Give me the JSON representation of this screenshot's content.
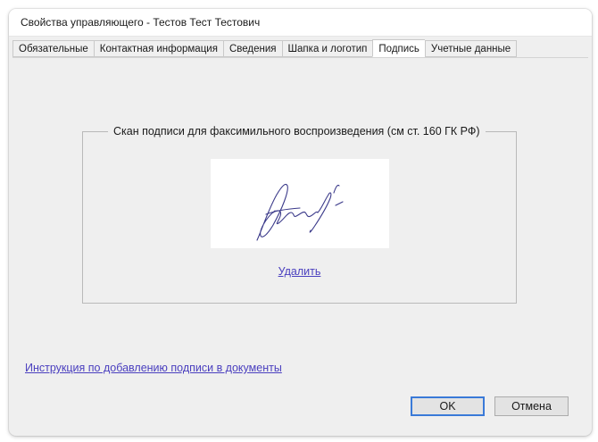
{
  "window": {
    "title": "Свойства управляющего - Тестов Тест Тестович"
  },
  "tabs": [
    {
      "label": "Обязательные",
      "active": false
    },
    {
      "label": "Контактная информация",
      "active": false
    },
    {
      "label": "Сведения",
      "active": false
    },
    {
      "label": "Шапка и логотип",
      "active": false
    },
    {
      "label": "Подпись",
      "active": true
    },
    {
      "label": "Учетные данные",
      "active": false
    }
  ],
  "signature": {
    "group_title": "Скан подписи для факсимильного воспроизведения (см ст. 160 ГК РФ)",
    "delete_label": "Удалить",
    "ink_color": "#3b3a8a"
  },
  "help_link": "Инструкция по добавлению подписи в документы",
  "buttons": {
    "ok": "OK",
    "cancel": "Отмена"
  },
  "colors": {
    "dialog_bg": "#efefef",
    "link": "#4a3fbf",
    "ok_focus_border": "#3a7ad8"
  }
}
